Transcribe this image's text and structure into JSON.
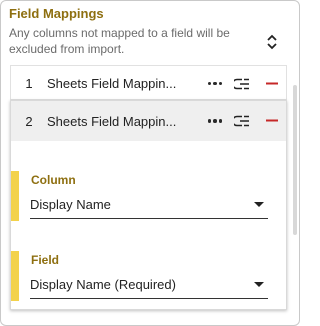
{
  "panel": {
    "title": "Field Mappings",
    "description": "Any columns not mapped to a field will be excluded from import."
  },
  "mappings": [
    {
      "index": "1",
      "name": "Sheets Field Mappin...",
      "expanded": false
    },
    {
      "index": "2",
      "name": "Sheets Field Mappin...",
      "expanded": true
    }
  ],
  "expanded_mapping": {
    "column_label": "Column",
    "column_value": "Display Name",
    "field_label": "Field",
    "field_value": "Display Name (Required)"
  },
  "icons": {
    "sort": "sort-toggle-icon",
    "more": "more-horizontal-icon",
    "reorder": "reorder-icon",
    "remove": "minus-icon"
  },
  "colors": {
    "label_gold": "#8e6f10",
    "accent_yellow": "#f3d24b",
    "remove_red": "#c62828",
    "expanded_header_bg": "#efefef"
  }
}
